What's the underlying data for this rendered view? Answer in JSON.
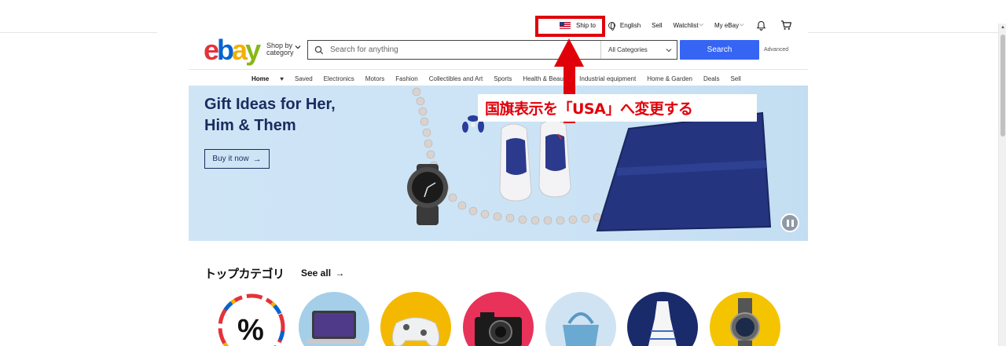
{
  "topbar": {
    "ship_to": "Ship to",
    "language": "English",
    "sell": "Sell",
    "watchlist": "Watchlist",
    "my_ebay": "My eBay"
  },
  "logo": {
    "e": "e",
    "b": "b",
    "a": "a",
    "y": "y"
  },
  "header": {
    "shop_by_line1": "Shop by",
    "shop_by_line2": "category",
    "search_placeholder": "Search for anything",
    "category_select": "All Categories",
    "search_button": "Search",
    "advanced": "Advanced"
  },
  "nav": {
    "items": [
      "Home",
      "Saved",
      "Electronics",
      "Motors",
      "Fashion",
      "Collectibles and Art",
      "Sports",
      "Health & Beauty",
      "Industrial equipment",
      "Home & Garden",
      "Deals",
      "Sell"
    ]
  },
  "banner": {
    "title_line1": "Gift Ideas for Her,",
    "title_line2": "Him & Them",
    "button": "Buy it now"
  },
  "annotation": {
    "text": "国旗表示を「USA」へ変更する",
    "color": "#e0000a"
  },
  "categories": {
    "title": "トップカテゴリ",
    "see_all": "See all",
    "discount_symbol": "%"
  },
  "colors": {
    "search_button": "#3665f3",
    "banner_bg": "#cfe5f6",
    "ebay_red": "#e53238",
    "ebay_blue": "#0064d2",
    "ebay_yellow": "#f5af02",
    "ebay_green": "#86b817"
  }
}
